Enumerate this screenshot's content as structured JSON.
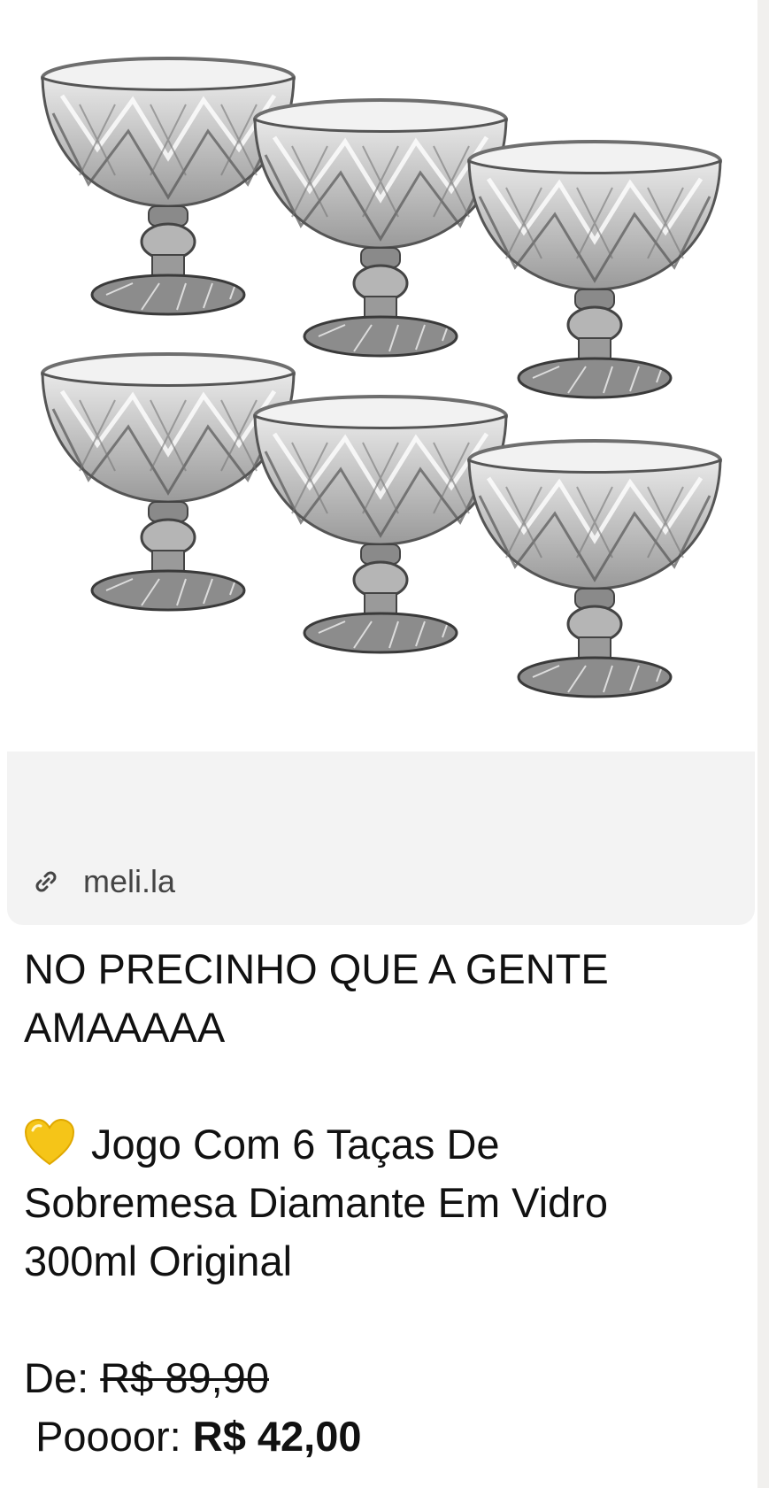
{
  "product_image": {
    "alt": "Conjunto de 6 taças de sobremesa diamante em vidro",
    "icon": "product-photo"
  },
  "link_preview": {
    "domain": "meli.la",
    "icon": "link-icon"
  },
  "message": {
    "headline_line1": "NO PRECINHO  QUE A GENTE",
    "headline_line2": "AMAAAAA",
    "emoji": "yellow-heart-icon",
    "product_line1": "Jogo Com 6 Taças De",
    "product_line2": "Sobremesa Diamante Em Vidro",
    "product_line3": "300ml Original",
    "old_price_label": "De:",
    "old_price": "R$ 89,90",
    "new_price_label": "Poooor:",
    "new_price": "R$ 42,00"
  },
  "colors": {
    "heart": "#f5c518",
    "preview_bg": "#f3f3f3",
    "text": "#111111"
  }
}
